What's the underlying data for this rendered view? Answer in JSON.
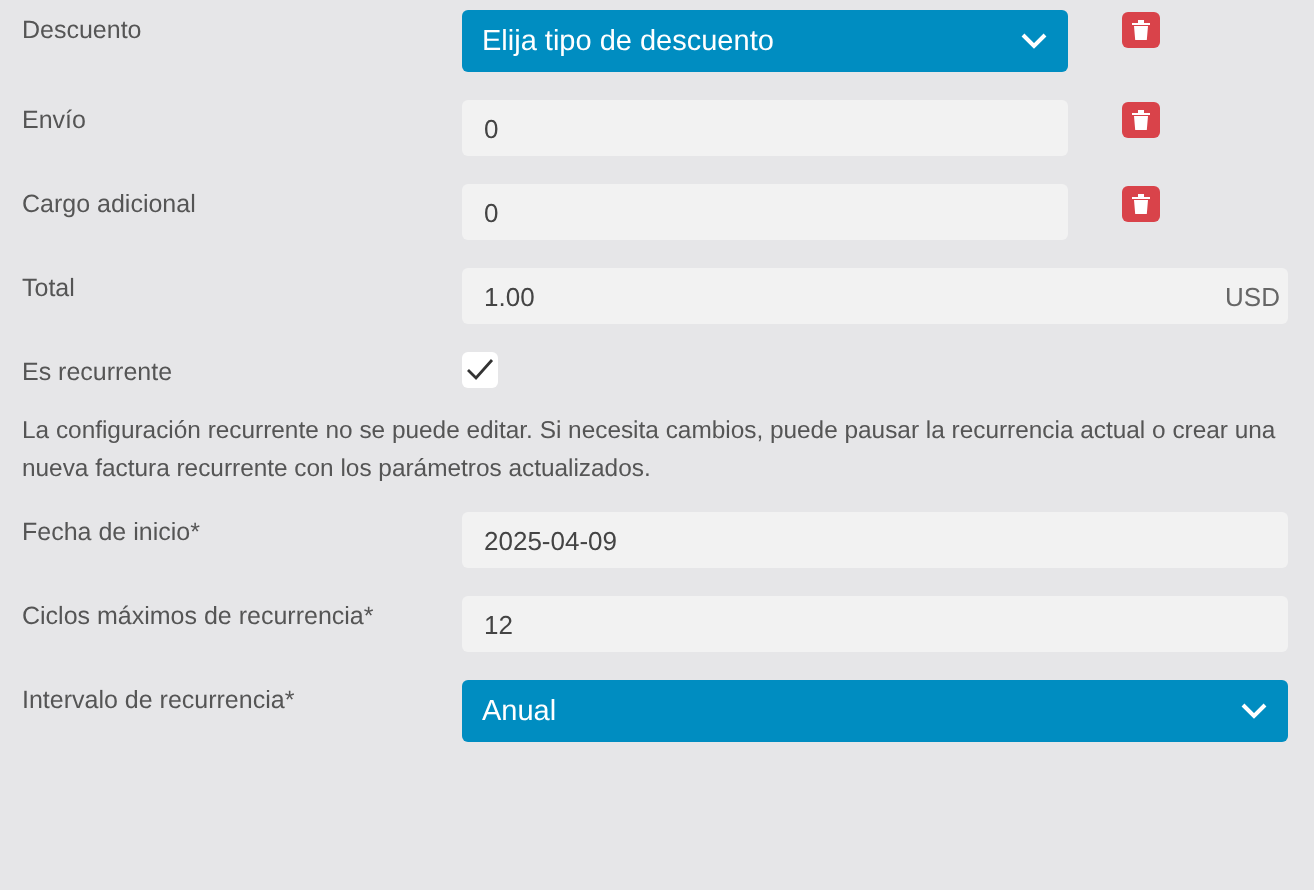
{
  "rows": [
    {
      "kind": "select",
      "label": "Descuento",
      "value": "Elija tipo de descuento",
      "deletable": true
    },
    {
      "kind": "input",
      "label": "Envío",
      "value": "0",
      "deletable": true
    },
    {
      "kind": "input",
      "label": "Cargo adicional",
      "value": "0",
      "deletable": true
    },
    {
      "kind": "input",
      "label": "Total",
      "value": "1.00",
      "suffix": "USD",
      "deletable": false
    },
    {
      "kind": "checkbox",
      "label": "Es recurrente",
      "checked": true
    },
    {
      "kind": "note",
      "text": "La configuración recurrente no se puede editar. Si necesita cambios, puede pausar la recurrencia actual o crear una nueva factura recurrente con los parámetros actualizados."
    },
    {
      "kind": "input",
      "label": "Fecha de inicio*",
      "value": "2025-04-09",
      "deletable": false
    },
    {
      "kind": "input",
      "label": "Ciclos máximos de recurrencia*",
      "value": "12",
      "deletable": false
    },
    {
      "kind": "select",
      "label": "Intervalo de recurrencia*",
      "value": "Anual",
      "deletable": false
    }
  ]
}
